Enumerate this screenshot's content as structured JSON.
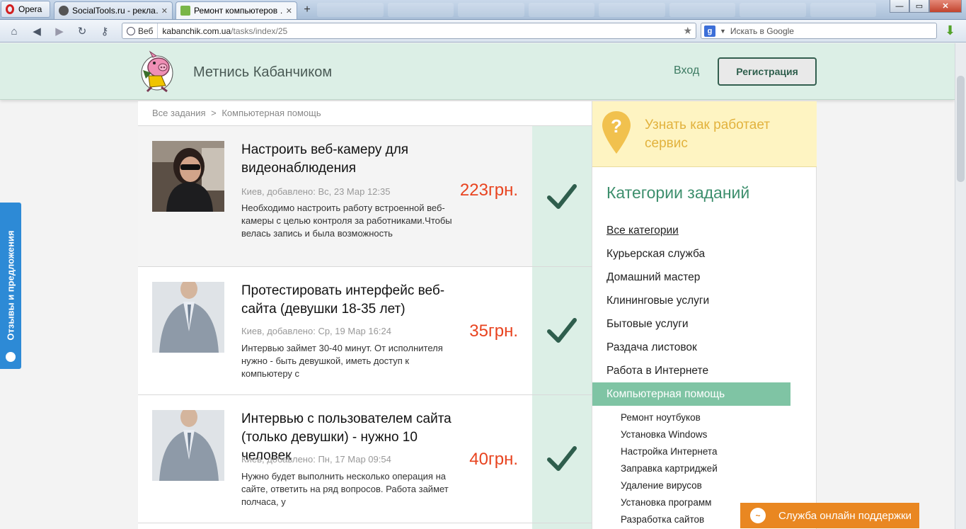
{
  "browser": {
    "opera_label": "Opera",
    "tabs": [
      {
        "title": "SocialTools.ru - рекла…",
        "fav_color": "#555555"
      },
      {
        "title": "Ремонт компьютеров …",
        "fav_color": "#7ab648"
      }
    ],
    "new_tab": "+",
    "address": {
      "web_label": "Веб",
      "domain": "kabanchik.com.ua",
      "path": "/tasks/index/25"
    },
    "search_placeholder": "Искать в Google",
    "google_letter": "g",
    "window_controls": {
      "minimize": "—",
      "maximize": "▭",
      "close": "✕"
    }
  },
  "header": {
    "logo_text": "Метнись Кабанчиком",
    "login": "Вход",
    "register": "Регистрация"
  },
  "feedback_tab": "Отзывы и предложения",
  "breadcrumb": {
    "root": "Все задания",
    "separator": ">",
    "current": "Компьютерная помощь"
  },
  "tasks": [
    {
      "title": "Настроить веб-камеру для видеонаблюдения",
      "meta": "Киев, добавлено: Вс, 23 Мар 12:35",
      "description": "Необходимо настроить работу встроенной веб-камеры с целью контроля за работниками.Чтобы велась запись и была возможность",
      "price": "223грн."
    },
    {
      "title": "Протестировать интерфейс веб-сайта (девушки 18-35 лет)",
      "meta": "Киев, добавлено: Ср, 19 Мар 16:24",
      "description": "Интервью займет 30-40 минут. От исполнителя нужно - быть девушкой, иметь доступ к компьютеру с",
      "price": "35грн."
    },
    {
      "title": "Интервью с пользователем сайта (только девушки) - нужно 10 человек",
      "meta": "Киев, добавлено: Пн, 17 Мар 09:54",
      "description": "Нужно будет выполнить несколько операция на сайте, ответить на ряд вопросов. Работа займет полчаса, у",
      "price": "40грн."
    }
  ],
  "sidebar": {
    "how_it_works": "Узнать как работает сервис",
    "categories_heading": "Категории заданий",
    "categories": [
      "Все категории",
      "Курьерская служба",
      "Домашний мастер",
      "Клининговые услуги",
      "Бытовые услуги",
      "Раздача листовок",
      "Работа в Интернете",
      "Компьютерная помощь"
    ],
    "subcategories": [
      "Ремонт ноутбуков",
      "Установка Windows",
      "Настройка Интернета",
      "Заправка картриджей",
      "Удаление вирусов",
      "Установка программ",
      "Разработка сайтов"
    ]
  },
  "support_button": "Служба онлайн поддержки",
  "colors": {
    "accent_green": "#3d8f6d",
    "header_bg": "#dcefe6",
    "price_red": "#e8431f",
    "active_category": "#7fc4a4",
    "support_orange": "#e98721",
    "feedback_blue": "#2d8ad6"
  }
}
